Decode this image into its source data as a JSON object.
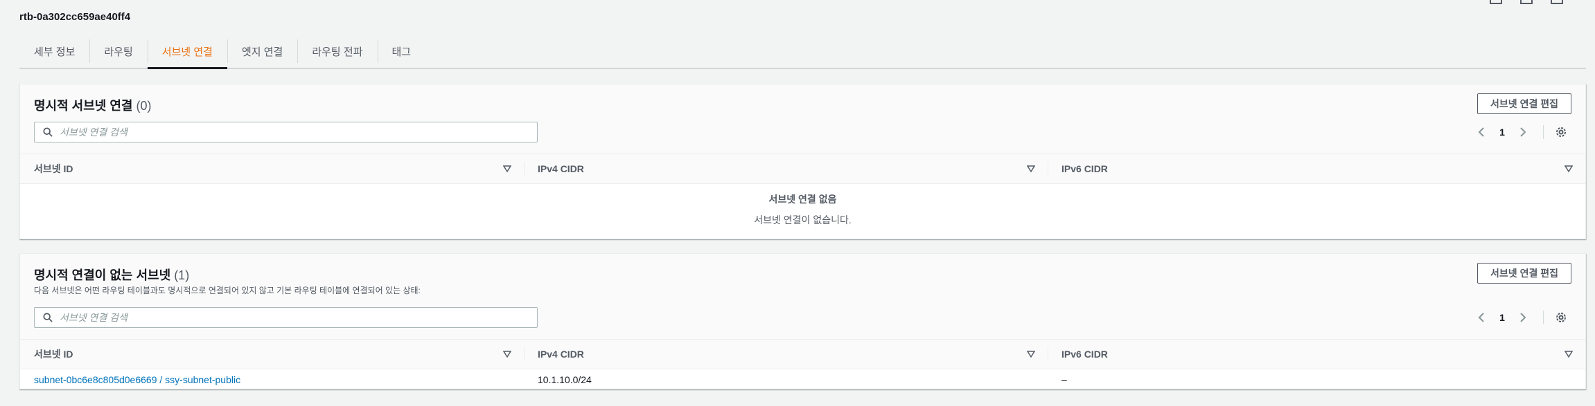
{
  "route_table_id": "rtb-0a302cc659ae40ff4",
  "tabs": [
    {
      "label": "세부 정보"
    },
    {
      "label": "라우팅"
    },
    {
      "label": "서브넷 연결"
    },
    {
      "label": "엣지 연결"
    },
    {
      "label": "라우팅 전파"
    },
    {
      "label": "태그"
    }
  ],
  "active_tab": "서브넷 연결",
  "explicit": {
    "title": "명시적 서브넷 연결",
    "count": "(0)",
    "edit_button": "서브넷 연결 편집",
    "search_placeholder": "서브넷 연결 검색",
    "page": "1",
    "columns": [
      "서브넷 ID",
      "IPv4 CIDR",
      "IPv6 CIDR"
    ],
    "empty_title": "서브넷 연결 없음",
    "empty_desc": "서브넷 연결이 없습니다."
  },
  "implicit": {
    "title": "명시적 연결이 없는 서브넷",
    "count": "(1)",
    "description": "다음 서브넷은 어떤 라우팅 테이블과도 명시적으로 연결되어 있지 않고 기본 라우팅 테이블에 연결되어 있는 상태:",
    "edit_button": "서브넷 연결 편집",
    "search_placeholder": "서브넷 연결 검색",
    "page": "1",
    "columns": [
      "서브넷 ID",
      "IPv4 CIDR",
      "IPv6 CIDR"
    ],
    "rows": [
      {
        "subnet": "subnet-0bc6e8c805d0e6669 / ssy-subnet-public",
        "ipv4": "10.1.10.0/24",
        "ipv6": "–"
      }
    ]
  },
  "colors": {
    "accent": "#ec7211",
    "link": "#0073bb",
    "text": "#16191f",
    "muted": "#545b64"
  },
  "icons": [
    "search-icon",
    "chevron-left-icon",
    "chevron-right-icon",
    "gear-icon",
    "sort-caret-icon"
  ]
}
